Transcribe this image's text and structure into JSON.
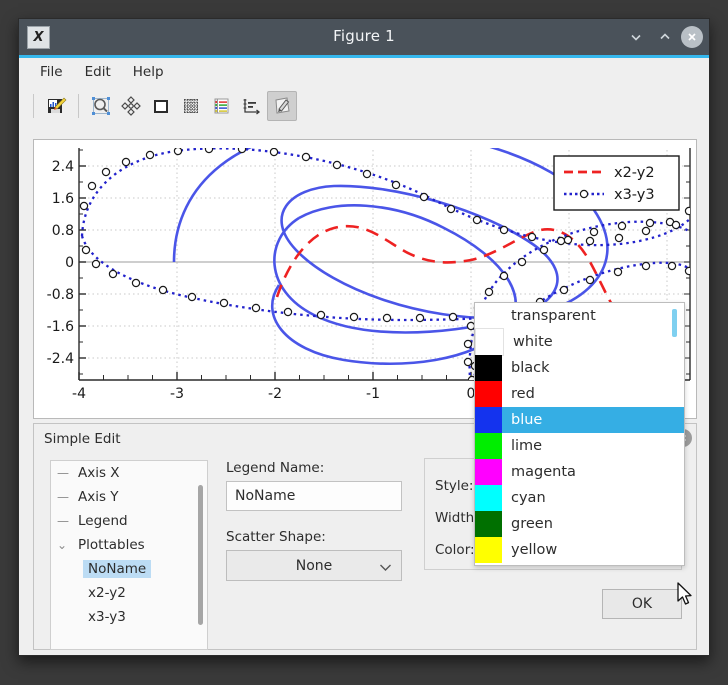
{
  "window": {
    "title": "Figure 1",
    "app_icon": "chart-app-icon",
    "controls": [
      {
        "name": "minimize-button",
        "glyph": "chevron-down-icon"
      },
      {
        "name": "maximize-button",
        "glyph": "chevron-up-icon"
      },
      {
        "name": "close-button",
        "glyph": "close-icon"
      }
    ]
  },
  "menubar": {
    "items": [
      {
        "label": "File"
      },
      {
        "label": "Edit"
      },
      {
        "label": "Help"
      }
    ]
  },
  "toolbar": {
    "buttons": [
      {
        "name": "save-figure-button",
        "icon": "save-chart-icon",
        "active": false
      },
      {
        "name": "zoom-region-button",
        "icon": "magnifier-icon",
        "active": false
      },
      {
        "name": "pan-button",
        "icon": "move-arrows-icon",
        "active": false
      },
      {
        "name": "rectangle-button",
        "icon": "square-icon",
        "active": false
      },
      {
        "name": "grid-button",
        "icon": "grid-icon",
        "active": false
      },
      {
        "name": "legend-button",
        "icon": "legend-list-icon",
        "active": false
      },
      {
        "name": "axes-button",
        "icon": "axes-icon",
        "active": false
      },
      {
        "name": "simple-edit-button",
        "icon": "pencil-edit-icon",
        "active": true
      }
    ]
  },
  "chart_data": {
    "type": "line",
    "title": "",
    "xlabel": "",
    "ylabel": "",
    "xlim": [
      -4.35,
      0.75
    ],
    "ylim": [
      -2.9,
      2.9
    ],
    "xticks": [
      -4,
      -3,
      -2,
      -1,
      0
    ],
    "yticks": [
      -2.4,
      -1.6,
      -0.8,
      0,
      0.8,
      1.6,
      2.4
    ],
    "grid": true,
    "legend_position": "top-right",
    "legend_entries": [
      {
        "label": "x2-y2",
        "color": "#ee2222",
        "style": "dashed",
        "marker": "none"
      },
      {
        "label": "x3-y3",
        "color": "#2222cc",
        "style": "dotted",
        "marker": "circle"
      }
    ],
    "series": [
      {
        "name": "NoName",
        "color": "#4a55e8",
        "style": "solid",
        "marker": "none",
        "description": "two nested blue parametric loops (solid)",
        "points": []
      },
      {
        "name": "x2-y2",
        "color": "#ee2222",
        "style": "dashed",
        "marker": "none",
        "description": "red dashed S-shaped wave",
        "points": []
      },
      {
        "name": "x3-y3",
        "color": "#2222cc",
        "style": "dotted",
        "marker": "circle",
        "description": "blue dotted large loop with open circle markers",
        "points": []
      }
    ]
  },
  "simple_edit": {
    "title": "Simple Edit",
    "close_icon": "close-icon",
    "tree": {
      "items": [
        {
          "label": "Axis X",
          "level": 0,
          "selected": false,
          "expander": ""
        },
        {
          "label": "Axis Y",
          "level": 0,
          "selected": false,
          "expander": ""
        },
        {
          "label": "Legend",
          "level": 0,
          "selected": false,
          "expander": ""
        },
        {
          "label": "Plottables",
          "level": 0,
          "selected": false,
          "expander": "expanded"
        },
        {
          "label": "NoName",
          "level": 1,
          "selected": true,
          "expander": ""
        },
        {
          "label": "x2-y2",
          "level": 1,
          "selected": false,
          "expander": ""
        },
        {
          "label": "x3-y3",
          "level": 1,
          "selected": false,
          "expander": ""
        }
      ]
    },
    "legend_name_label": "Legend Name:",
    "legend_name_value": "NoName",
    "scatter_shape_label": "Scatter Shape:",
    "scatter_shape_value": "None",
    "style_label": "Style:",
    "style_value": "",
    "width_label": "Width:",
    "width_value": "",
    "color_label": "Color:",
    "color_value": "blue",
    "color_hex": "#0000ee",
    "ok_label": "OK"
  },
  "color_dropdown": {
    "options": [
      {
        "label": "transparent",
        "hex": "",
        "selected": false
      },
      {
        "label": "white",
        "hex": "#ffffff",
        "selected": false
      },
      {
        "label": "black",
        "hex": "#000000",
        "selected": false
      },
      {
        "label": "red",
        "hex": "#ff0000",
        "selected": false
      },
      {
        "label": "blue",
        "hex": "#1433ee",
        "selected": true
      },
      {
        "label": "lime",
        "hex": "#00ee00",
        "selected": false
      },
      {
        "label": "magenta",
        "hex": "#ff00ff",
        "selected": false
      },
      {
        "label": "cyan",
        "hex": "#00ffff",
        "selected": false
      },
      {
        "label": "green",
        "hex": "#007000",
        "selected": false
      },
      {
        "label": "yellow",
        "hex": "#ffff00",
        "selected": false
      }
    ]
  }
}
